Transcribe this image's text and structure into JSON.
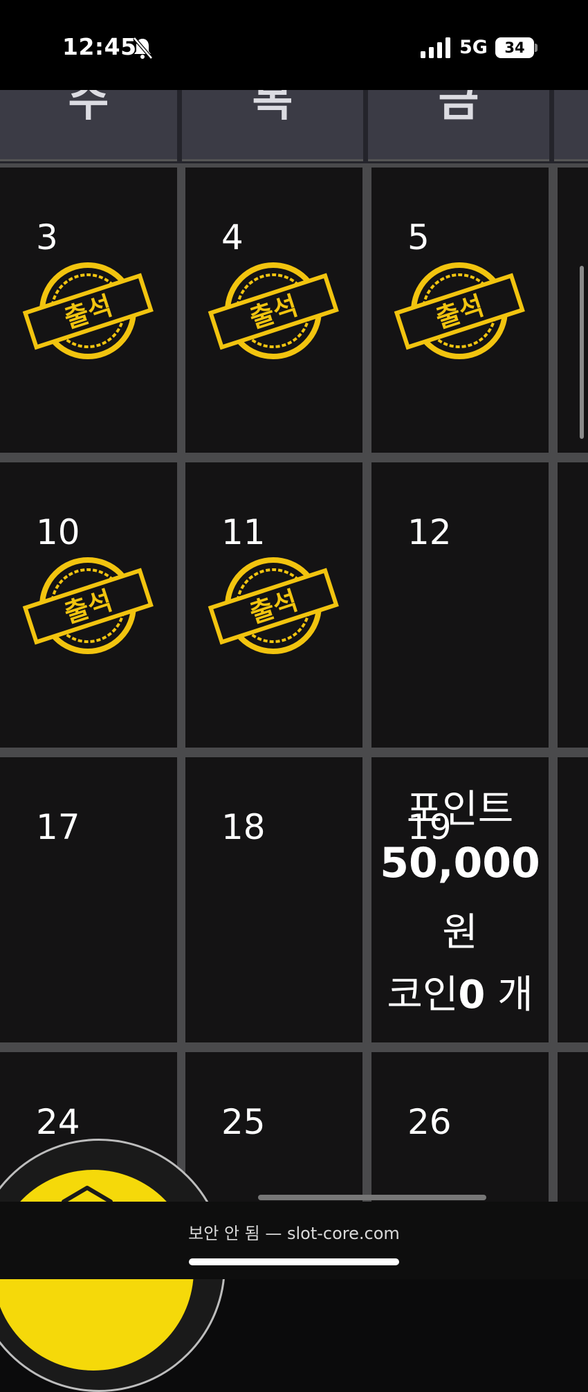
{
  "status_bar": {
    "time": "12:45",
    "network": "5G",
    "battery": "34"
  },
  "weekday_header": [
    "수",
    "목",
    "금"
  ],
  "calendar": {
    "rows": [
      [
        {
          "day": "3",
          "stamp": "출석"
        },
        {
          "day": "4",
          "stamp": "출석"
        },
        {
          "day": "5",
          "stamp": "출석"
        }
      ],
      [
        {
          "day": "10",
          "stamp": "출석"
        },
        {
          "day": "11",
          "stamp": "출석"
        },
        {
          "day": "12",
          "stamp": ""
        }
      ],
      [
        {
          "day": "17",
          "stamp": ""
        },
        {
          "day": "18",
          "stamp": ""
        },
        {
          "day": "19",
          "stamp": ""
        }
      ],
      [
        {
          "day": "24",
          "stamp": ""
        },
        {
          "day": "25",
          "stamp": ""
        },
        {
          "day": "26",
          "stamp": ""
        }
      ]
    ],
    "prize": {
      "line1": "포인트",
      "amount": "50,000",
      "unit": "원",
      "coin_label": "코인",
      "coin_count": "0",
      "coin_unit": " 개"
    }
  },
  "browser": {
    "url_text": "보안 안 됨 — slot-core.com"
  },
  "colors": {
    "stamp": "#f2c40f",
    "fab": "#f5d90a",
    "grid_line": "#4a4a4c",
    "cell": "#141314"
  }
}
